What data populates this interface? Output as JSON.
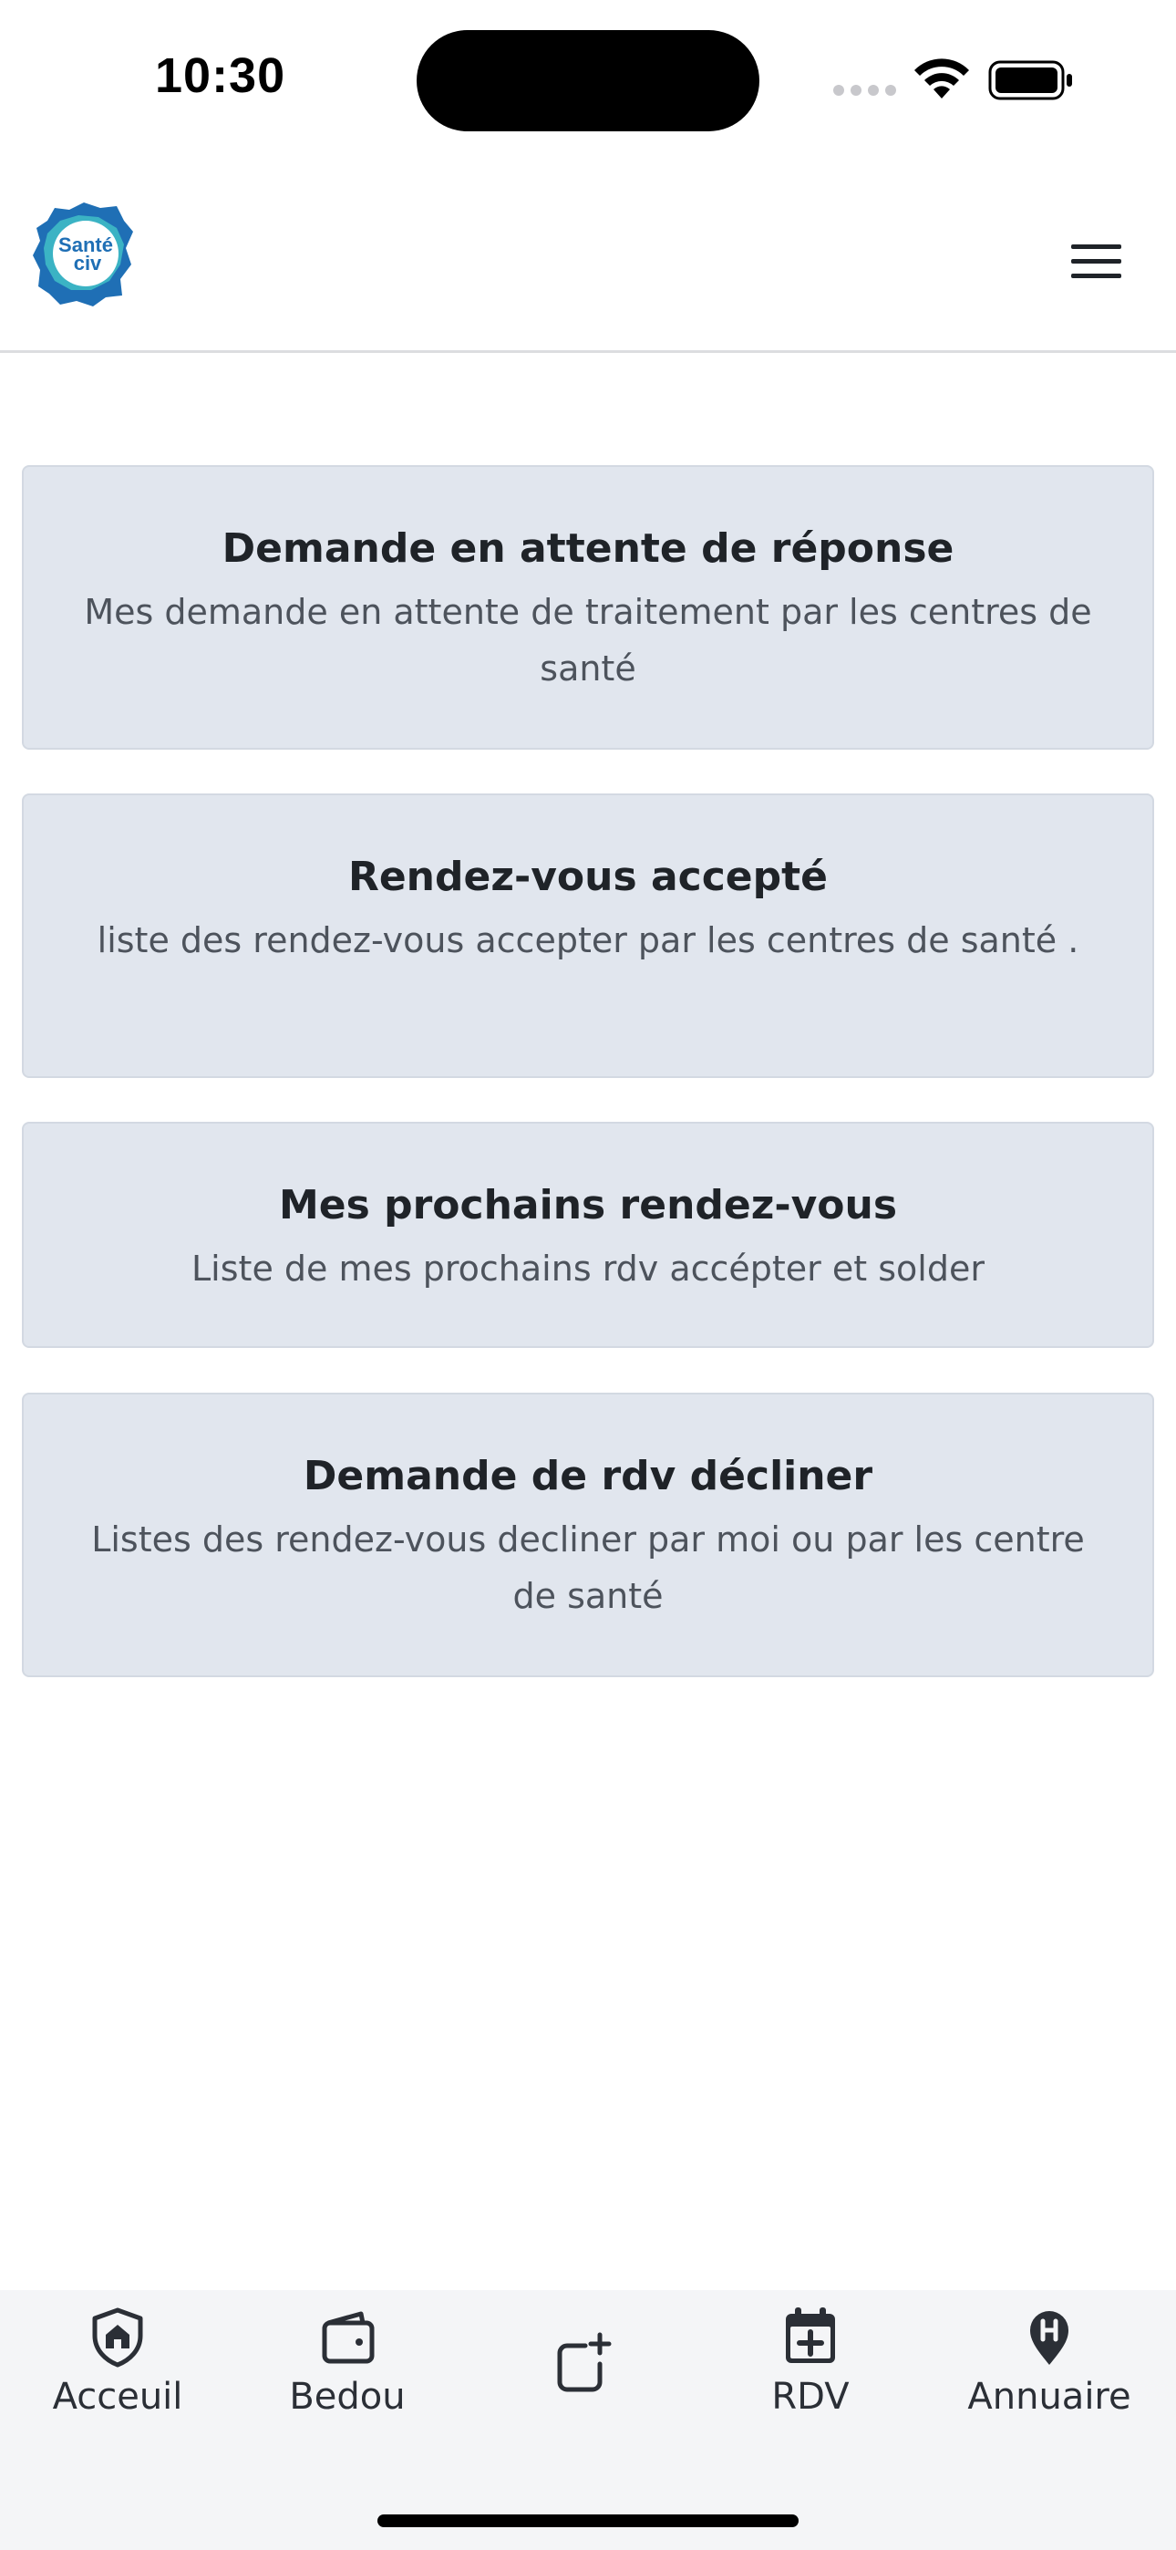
{
  "status_bar": {
    "time": "10:30"
  },
  "header": {
    "logo_line1": "Santé",
    "logo_line2": "civ",
    "menu_icon": "hamburger-menu-icon"
  },
  "cards": [
    {
      "title": "Demande en attente de réponse",
      "description": "Mes demande en attente de traitement par les centres de santé"
    },
    {
      "title": "Rendez-vous accepté",
      "description": "liste des rendez-vous accepter par les centres de santé ."
    },
    {
      "title": "Mes prochains rendez-vous",
      "description": "Liste de mes prochains rdv accépter et solder"
    },
    {
      "title": "Demande de rdv décliner",
      "description": "Listes des rendez-vous decliner par moi ou par les centre de santé"
    }
  ],
  "bottom_nav": {
    "items": [
      {
        "label": "Acceuil",
        "icon": "shield-home-icon"
      },
      {
        "label": "Bedou",
        "icon": "wallet-icon"
      },
      {
        "label": "",
        "icon": "add-square-icon"
      },
      {
        "label": "RDV",
        "icon": "calendar-add-icon"
      },
      {
        "label": "Annuaire",
        "icon": "hospital-pin-icon"
      }
    ]
  },
  "colors": {
    "card_bg": "#e1e6ee",
    "logo_blue": "#1f6fb5",
    "logo_teal": "#3bb3c4",
    "nav_bg": "#f4f5f7"
  }
}
